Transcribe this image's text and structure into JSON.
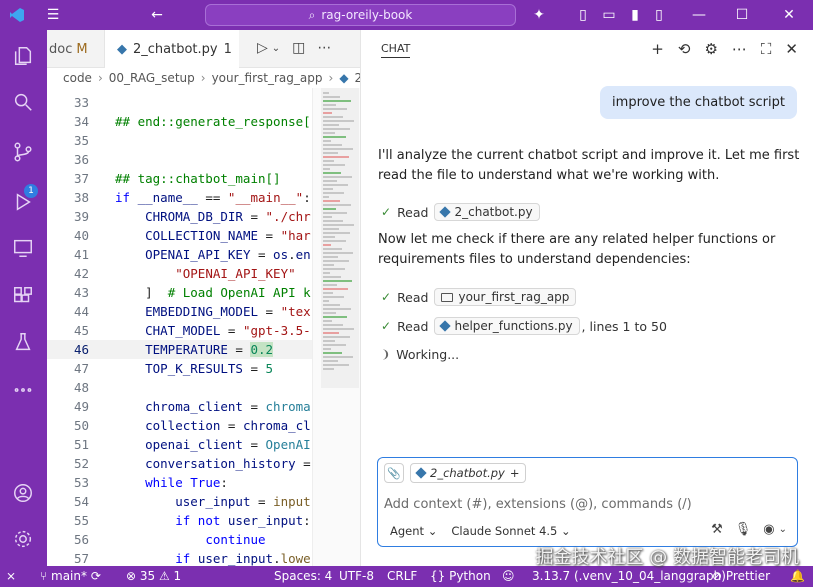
{
  "titlebar": {
    "search_text": "rag-oreily-book",
    "icons": [
      "vscode-logo-icon",
      "menu-icon",
      "back-icon",
      "search-icon",
      "copilot-icon",
      "layout-icon",
      "minimize-icon",
      "maximize-icon",
      "close-icon"
    ]
  },
  "activity": {
    "scm_badge": "1",
    "icons": [
      "explorer-icon",
      "search-icon",
      "source-control-icon",
      "run-debug-icon",
      "remote-explorer-icon",
      "extensions-icon",
      "testing-icon",
      "more-icon",
      "account-icon",
      "settings-icon"
    ]
  },
  "tabs": {
    "inactive_label": "doc",
    "inactive_status": "M",
    "active_label": "2_chatbot.py",
    "active_count": "1"
  },
  "breadcrumb": [
    "code",
    "00_RAG_setup",
    "your_first_rag_app",
    "2_"
  ],
  "editor": {
    "lines": [
      {
        "n": "33",
        "html": ""
      },
      {
        "n": "34",
        "html": "<span class='c'>## end::generate_response[]</span>"
      },
      {
        "n": "35",
        "html": ""
      },
      {
        "n": "36",
        "html": ""
      },
      {
        "n": "37",
        "html": "<span class='c'>## tag::chatbot_main[]</span>"
      },
      {
        "n": "38",
        "html": "<span class='k'>if</span> <span class='v'>__name__</span> == <span class='s'>\"__main__\"</span>:"
      },
      {
        "n": "39",
        "html": "    <span class='v'>CHROMA_DB_DIR</span> = <span class='s'>\"./chr</span>"
      },
      {
        "n": "40",
        "html": "    <span class='v'>COLLECTION_NAME</span> = <span class='s'>\"har</span>"
      },
      {
        "n": "41",
        "html": "    <span class='v'>OPENAI_API_KEY</span> = <span class='v'>os</span>.<span class='v'>en</span>"
      },
      {
        "n": "42",
        "html": "        <span class='s'>\"OPENAI_API_KEY\"</span>"
      },
      {
        "n": "43",
        "html": "    ]  <span class='c'># Load OpenAI API k</span>"
      },
      {
        "n": "44",
        "html": "    <span class='v'>EMBEDDING_MODEL</span> = <span class='s'>\"tex</span>"
      },
      {
        "n": "45",
        "html": "    <span class='v'>CHAT_MODEL</span> = <span class='s'>\"gpt-3.5-</span>"
      },
      {
        "n": "46",
        "html": "    <span class='v'>TEMPERATURE</span> = <span class='n sel'>0.2</span>",
        "current": true
      },
      {
        "n": "47",
        "html": "    <span class='v'>TOP_K_RESULTS</span> = <span class='n'>5</span>"
      },
      {
        "n": "48",
        "html": ""
      },
      {
        "n": "49",
        "html": "    <span class='v'>chroma_client</span> = <span class='t'>chroma</span>"
      },
      {
        "n": "50",
        "html": "    <span class='v'>collection</span> = <span class='v'>chroma_cl</span>"
      },
      {
        "n": "51",
        "html": "    <span class='v'>openai_client</span> = <span class='t'>OpenAI</span>"
      },
      {
        "n": "52",
        "html": "    <span class='v'>conversation_history</span> ="
      },
      {
        "n": "53",
        "html": "    <span class='k'>while</span> <span class='k'>True</span>:"
      },
      {
        "n": "54",
        "html": "        <span class='v'>user_input</span> = <span class='f'>input</span>"
      },
      {
        "n": "55",
        "html": "        <span class='k'>if not</span> <span class='v'>user_input</span>:"
      },
      {
        "n": "56",
        "html": "            <span class='k'>continue</span>"
      },
      {
        "n": "57",
        "html": "        <span class='k'>if</span> <span class='v'>user_input</span>.<span class='f'>lowe</span>"
      }
    ]
  },
  "chat": {
    "title": "CHAT",
    "header_icons": [
      "new-chat-icon",
      "history-icon",
      "settings-icon",
      "more-icon",
      "maximize-icon",
      "close-icon"
    ],
    "user_message": "improve the chatbot script",
    "para1": "I'll analyze the current chatbot script and improve it. Let me first read the file to understand what we're working with.",
    "step1_label": "Read",
    "step1_file": "2_chatbot.py",
    "para2": "Now let me check if there are any related helper functions or requirements files to understand dependencies:",
    "step2_label": "Read",
    "step2_folder": "your_first_rag_app",
    "step3_label": "Read",
    "step3_file": "helper_functions.py",
    "step3_suffix": ", lines 1 to 50",
    "working": "Working...",
    "input": {
      "context_chip": "2_chatbot.py",
      "placeholder": "Add context (#), extensions (@), commands (/)",
      "agent": "Agent",
      "model": "Claude Sonnet 4.5"
    }
  },
  "statusbar": {
    "branch": "main*",
    "errors": "35",
    "warnings": "1",
    "spaces": "Spaces: 4",
    "encoding": "UTF-8",
    "eol": "CRLF",
    "language": "Python",
    "interpreter": "3.13.7 (.venv_10_04_langgraph)",
    "formatter": "Prettier"
  },
  "watermark": "掘金技术社区 @ 数据智能老司机",
  "colors": {
    "accent": "#7b2fb0",
    "focus": "#2f7de1",
    "user_bubble": "#dbe8fb"
  }
}
